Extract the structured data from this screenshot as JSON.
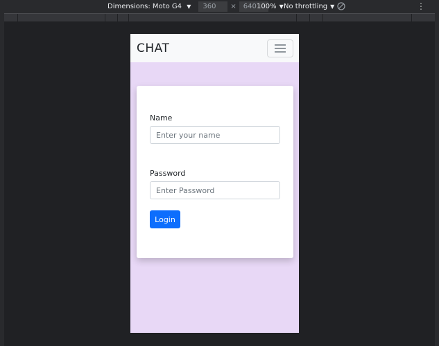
{
  "devtools": {
    "dimensions_label": "Dimensions: Moto G4",
    "width": "360",
    "times": "×",
    "height": "640",
    "zoom": "100%",
    "throttling": "No throttling",
    "caret": "▼",
    "more": "⋮"
  },
  "navbar": {
    "brand": "CHAT",
    "toggler_icon": "hamburger-menu-icon"
  },
  "form": {
    "name_label": "Name",
    "name_placeholder": "Enter your name",
    "password_label": "Password",
    "password_placeholder": "Enter Password",
    "login_label": "Login"
  },
  "colors": {
    "page_background": "#e8d8f6",
    "navbar_background": "#f8f9fa",
    "primary_button": "#0d6efd"
  }
}
